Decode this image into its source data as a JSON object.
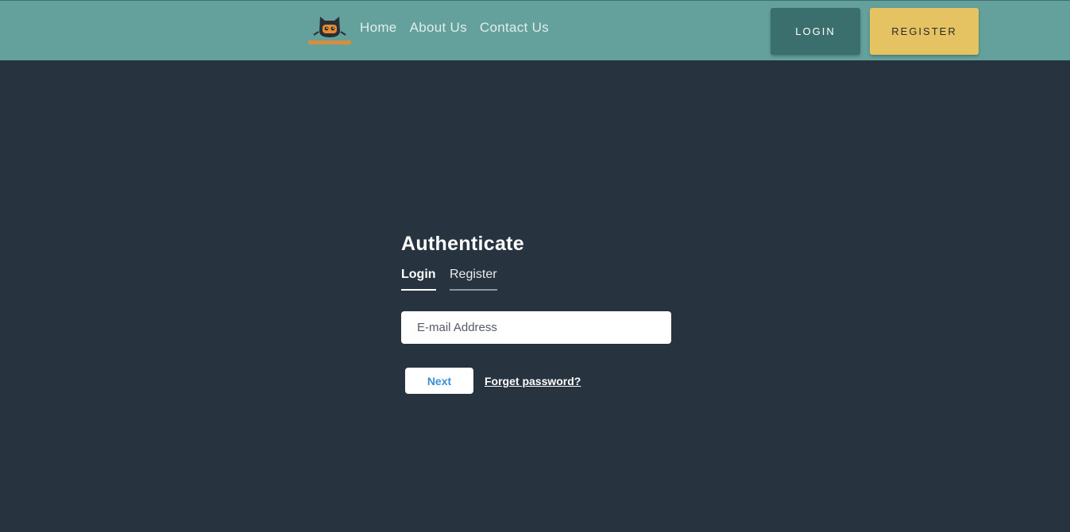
{
  "navbar": {
    "links": [
      "Home",
      "About Us",
      "Contact Us"
    ],
    "login_label": "LOGIN",
    "register_label": "REGISTER",
    "logo_icon": "mascot-logo-icon"
  },
  "auth": {
    "title": "Authenticate",
    "tabs": [
      "Login",
      "Register"
    ],
    "active_tab": "Login",
    "email_placeholder": "E-mail Address",
    "email_value": "",
    "next_label": "Next",
    "forget_label": "Forget password?"
  },
  "colors": {
    "navbar_bg": "#64a19c",
    "page_bg": "#27333e",
    "login_button_bg": "#3b6f6d",
    "register_button_bg": "#e6c362",
    "next_text": "#3c8fd6"
  }
}
